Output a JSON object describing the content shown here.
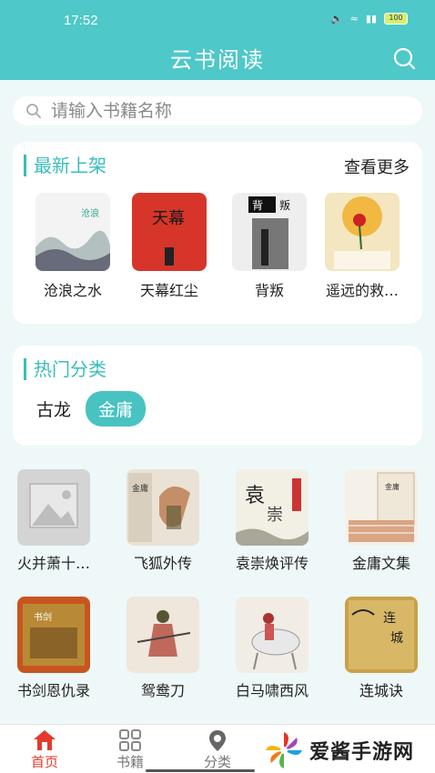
{
  "status_bar": {
    "time": "17:52",
    "battery": "100"
  },
  "header": {
    "title": "云书阅读"
  },
  "search": {
    "placeholder": "请输入书籍名称"
  },
  "new_arrivals": {
    "title": "最新上架",
    "more": "查看更多",
    "books": [
      {
        "title": "沧浪之水"
      },
      {
        "title": "天幕红尘"
      },
      {
        "title": "背叛"
      },
      {
        "title": "遥远的救…"
      }
    ]
  },
  "hot_categories": {
    "title": "热门分类",
    "tags": [
      {
        "label": "古龙"
      },
      {
        "label": "金庸"
      }
    ]
  },
  "category_books": [
    {
      "title": "火并萧十…"
    },
    {
      "title": "飞狐外传"
    },
    {
      "title": "袁崇焕评传"
    },
    {
      "title": "金庸文集"
    },
    {
      "title": "书剑恩仇录"
    },
    {
      "title": "鸳鸯刀"
    },
    {
      "title": "白马啸西风"
    },
    {
      "title": "连城诀"
    }
  ],
  "bottom_nav": {
    "items": [
      {
        "label": "首页"
      },
      {
        "label": "书籍"
      },
      {
        "label": "分类"
      }
    ]
  },
  "watermark": {
    "text": "爱酱手游网"
  },
  "colors": {
    "accent": "#4ec8c8",
    "active_nav": "#e43a2b"
  }
}
